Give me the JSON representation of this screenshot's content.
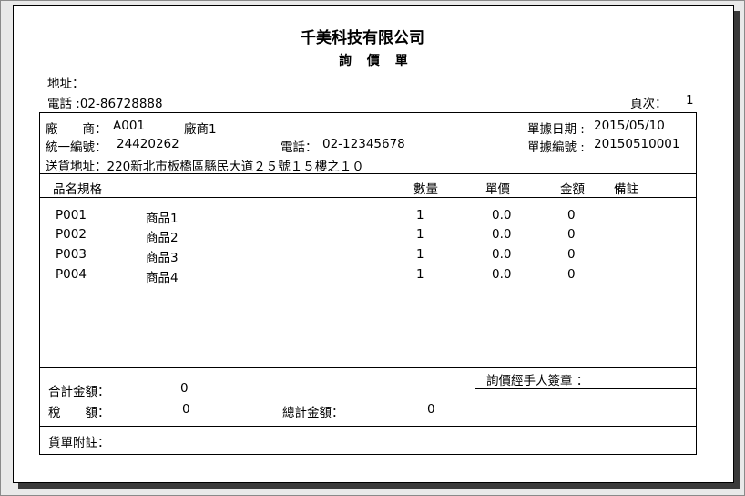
{
  "header": {
    "company": "千美科技有限公司",
    "doc_title": "詢 價 單",
    "address_label": "地址：",
    "phone_label": "電話 :",
    "phone": "02-86728888",
    "page_label": "頁次：",
    "page_no": "1"
  },
  "vendor": {
    "label": "廠　　商：",
    "code": "A001",
    "name": "廠商1",
    "tax_label": "統一編號：",
    "tax_id": "24420262",
    "phone_label": "電話：",
    "phone": "02-12345678",
    "ship_label": "送貨地址：",
    "ship_address": "220新北市板橋區縣民大道２５號１５樓之１０"
  },
  "doc": {
    "date_label": "單據日期 :",
    "date": "2015/05/10",
    "no_label": "單據編號 :",
    "no": "20150510001"
  },
  "table": {
    "headers": {
      "spec": "品名規格",
      "qty": "數量",
      "price": "單價",
      "amount": "金額",
      "note": "備註"
    },
    "rows": [
      {
        "code": "P001",
        "name": "商品1",
        "qty": "1",
        "price": "0.0",
        "amount": "0"
      },
      {
        "code": "P002",
        "name": "商品2",
        "qty": "1",
        "price": "0.0",
        "amount": "0"
      },
      {
        "code": "P003",
        "name": "商品3",
        "qty": "1",
        "price": "0.0",
        "amount": "0"
      },
      {
        "code": "P004",
        "name": "商品4",
        "qty": "1",
        "price": "0.0",
        "amount": "0"
      }
    ]
  },
  "totals": {
    "subtotal_label": "合計金額：",
    "subtotal": "0",
    "tax_label": "稅　　額：",
    "tax": "0",
    "grand_label": "總計金額：",
    "grand": "0"
  },
  "sign": {
    "label": "詢價經手人簽章 ："
  },
  "remark": {
    "label": "貨單附註："
  }
}
